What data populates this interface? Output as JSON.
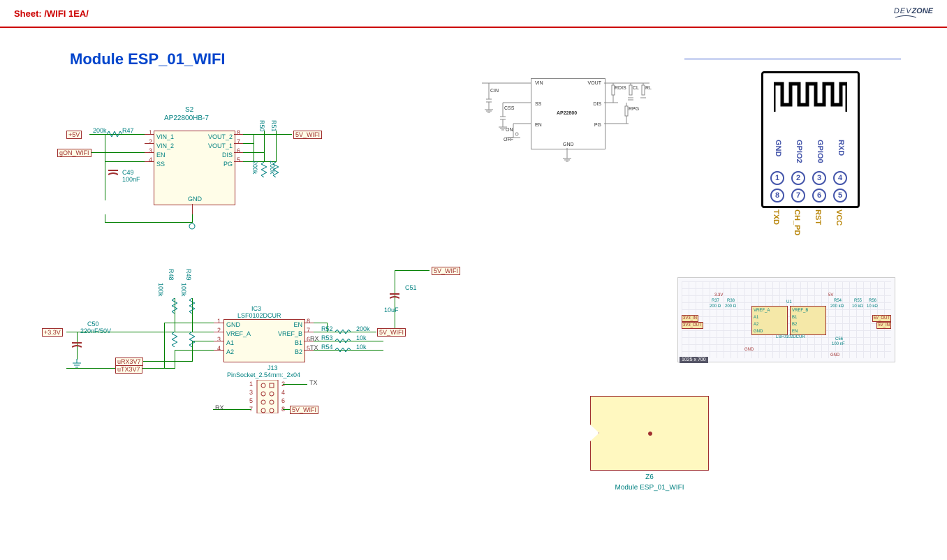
{
  "header": {
    "sheet_title": "Sheet: /WIFI 1EA/",
    "logo_dev": "DEV",
    "logo_zone": "ZONE"
  },
  "module_title": "Module ESP_01_WIFI",
  "s2": {
    "ref": "S2",
    "part": "AP22800HB-7",
    "pins_left": [
      "VIN_1",
      "VIN_2",
      "EN",
      "SS"
    ],
    "pin_nums_left": [
      "1",
      "2",
      "3",
      "4"
    ],
    "pins_right": [
      "VOUT_2",
      "VOUT_1",
      "DIS",
      "PG"
    ],
    "pin_nums_right": [
      "8",
      "7",
      "6",
      "5"
    ],
    "gnd": "GND",
    "in_flags": [
      "+5V",
      "gON_WIFI"
    ],
    "out_flag": "5V_WIFI",
    "r47": "R47",
    "r47_val": "200k",
    "r50": "R50",
    "r51": "R51",
    "r50_val": "200k",
    "r51_val": "200k",
    "c49": "C49",
    "c49_val": "100nF"
  },
  "ic3": {
    "ref": "IC3",
    "part": "LSF0102DCUR",
    "pins_left": [
      "GND",
      "VREF_A",
      "A1",
      "A2"
    ],
    "pin_nums_left": [
      "1",
      "2",
      "3",
      "4"
    ],
    "pins_right": [
      "EN",
      "VREF_B",
      "B1",
      "B2"
    ],
    "pin_nums_right": [
      "8",
      "7",
      "6",
      "5"
    ],
    "r48": "R48",
    "r48_val": "100k",
    "r49": "R49",
    "r49_val": "100k",
    "r52": "R52",
    "r52_val": "200k",
    "r53": "R53",
    "r53_val": "10k",
    "r54": "R54",
    "r54_val": "10k",
    "c50": "C50",
    "c50_val": "220nF/50V",
    "c51": "C51",
    "c51_val": "10uF",
    "pwr_in": "+3.3V",
    "pwr_out": "5V_WIFI",
    "pwr_out2": "5V_WIFI",
    "urx": "uRX3V7",
    "utx": "uTX3V7",
    "rx_lbl": "RX",
    "tx_lbl": "TX"
  },
  "j13": {
    "ref": "J13",
    "part": "PinSocket_2.54mm:_2x04",
    "nums": [
      "1",
      "2",
      "3",
      "4",
      "5",
      "6",
      "7",
      "8"
    ],
    "tx": "TX",
    "rx": "RX",
    "flag": "5V_WIFI"
  },
  "ref1": {
    "name": "AP22800",
    "pins": [
      "VIN",
      "SS",
      "EN",
      "VOUT",
      "DIS",
      "PG",
      "GND"
    ],
    "cin": "CIN",
    "css": "CSS",
    "on": "ON",
    "off": "OFF",
    "rdis": "RDIS",
    "rpg": "RPG",
    "cl": "CL",
    "rl": "RL"
  },
  "esp01": {
    "top_labels": [
      "GND",
      "GPIO2",
      "GPIO0",
      "RXD"
    ],
    "top_nums": [
      "1",
      "2",
      "3",
      "4"
    ],
    "bot_nums": [
      "8",
      "7",
      "6",
      "5"
    ],
    "bot_labels": [
      "TXD",
      "CH_PD",
      "RST",
      "VCC"
    ]
  },
  "ref2": {
    "left_port": "3V3_IN",
    "right_port": "5V_OUT",
    "left_port2": "3V3_OUT",
    "right_port2": "5V_IN",
    "u": "U1",
    "part": "LSF0102DCUR",
    "va": "VREF_A",
    "vb": "VREF_B",
    "a1": "A1",
    "a2": "A2",
    "b1": "B1",
    "b2": "B2",
    "en": "EN",
    "gnd": "GND",
    "r1": "R37",
    "r1v": "200 Ω",
    "r2": "R38",
    "r2v": "200 Ω",
    "r3": "R54",
    "r3v": "200 kΩ",
    "r4": "R55",
    "r4v": "10 kΩ",
    "r5": "R56",
    "r5v": "10 kΩ",
    "c": "C56",
    "cv": "100 nF",
    "gnd1": "GND",
    "gnd2": "GND",
    "v33": "3.3V",
    "v5": "5V",
    "size": "1025 x 700"
  },
  "z6": {
    "ref": "Z6",
    "name": "Module ESP_01_WIFI"
  }
}
